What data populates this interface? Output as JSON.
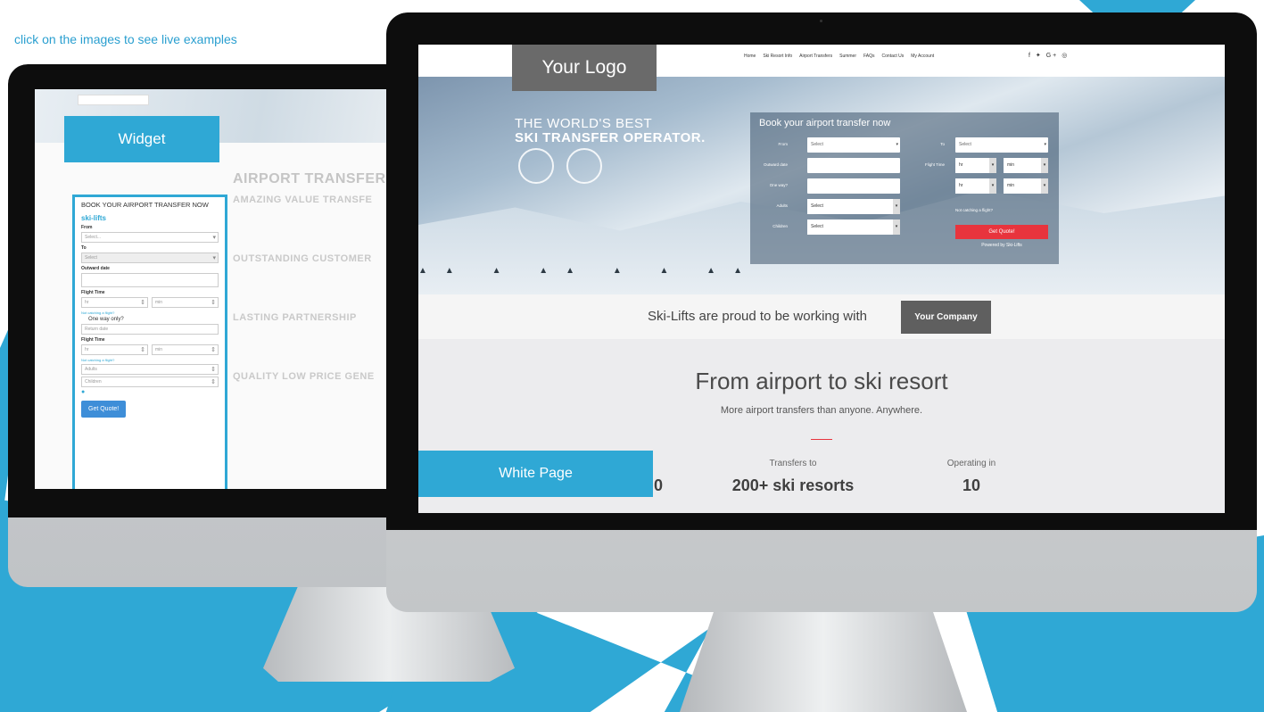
{
  "caption": "click on the images to see live examples",
  "colors": {
    "accent": "#2fa8d5",
    "quote_button": "#e8343d",
    "logo_box": "#6a6a6a"
  },
  "left_screen": {
    "label": "Widget",
    "widget": {
      "title": "BOOK YOUR AIRPORT TRANSFER NOW",
      "brand": "ski-lifts",
      "from_label": "From",
      "from_value": "Select...",
      "to_label": "To",
      "to_value": "Select",
      "outward_label": "Outward date",
      "flight_time_label": "Flight Time",
      "hr": "hr",
      "min": "min",
      "flight_link": "Not catching a flight?",
      "one_way": "One way only?",
      "return_date": "Return date",
      "flight_time_label_2": "Flight Time",
      "adults": "Adults",
      "children": "Children",
      "button": "Get Quote!"
    },
    "article": {
      "heading": "AIRPORT TRANSFERS",
      "sections": [
        {
          "title": "AMAZING VALUE TRANSFE"
        },
        {
          "title": "OUTSTANDING CUSTOMER"
        },
        {
          "title": "LASTING PARTNERSHIP"
        },
        {
          "title": "QUALITY LOW PRICE GENE"
        }
      ]
    }
  },
  "right_screen": {
    "logo": "Your Logo",
    "nav": [
      "Home",
      "Ski Resort Info",
      "Airport Transfers",
      "Summer",
      "FAQs",
      "Contact Us",
      "My Account"
    ],
    "social_icons": [
      "facebook-icon",
      "twitter-icon",
      "google-plus-icon",
      "instagram-icon"
    ],
    "tagline_1": "THE WORLD'S BEST",
    "tagline_2": "SKI TRANSFER OPERATOR.",
    "form": {
      "title": "Book your airport transfer now",
      "from_label": "From",
      "from_value": "Select",
      "to_label": "To",
      "to_value": "Select",
      "outward_label": "Outward date",
      "flight_time_label": "Flight Time",
      "one_way_label": "One way?",
      "adults_label": "Adults",
      "adults_value": "Select",
      "children_label": "Children",
      "children_value": "Select",
      "hr": "hr",
      "min": "min",
      "flight_link": "Not catching a flight?",
      "button": "Get Quote!",
      "powered": "Powered by Ski-Lifts"
    },
    "partner_text": "Ski-Lifts are proud to be working with",
    "partner_company": "Your Company",
    "headline": "From airport to ski resort",
    "subheadline": "More airport transfers than anyone. Anywhere.",
    "stats": [
      {
        "label": "",
        "value": "0"
      },
      {
        "label": "Transfers to",
        "value": "200+ ski resorts"
      },
      {
        "label": "Operating in",
        "value": "10"
      }
    ],
    "label": "White Page"
  }
}
